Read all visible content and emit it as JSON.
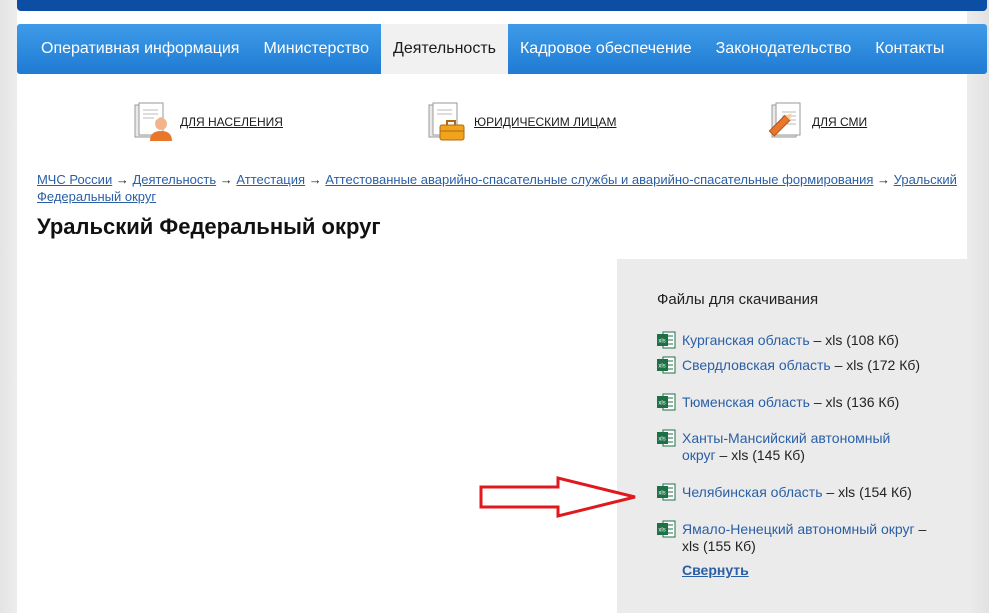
{
  "nav": {
    "items": [
      {
        "label": "Оперативная информация"
      },
      {
        "label": "Министерство"
      },
      {
        "label": "Деятельность"
      },
      {
        "label": "Кадровое обеспечение"
      },
      {
        "label": "Законодательство"
      },
      {
        "label": "Контакты"
      }
    ],
    "active": "Деятельность"
  },
  "audience": {
    "population": "ДЛЯ НАСЕЛЕНИЯ",
    "legal": "ЮРИДИЧЕСКИМ ЛИЦАМ",
    "media": "ДЛЯ СМИ"
  },
  "breadcrumb": {
    "items": [
      "МЧС России",
      "Деятельность",
      "Аттестация",
      "Аттестованные аварийно-спасательные службы и аварийно-спасательные формирования",
      "Уральский Федеральный округ"
    ],
    "separator": "→"
  },
  "page": {
    "title": "Уральский Федеральный округ"
  },
  "downloads": {
    "title": "Файлы для скачивания",
    "files": [
      {
        "name": "Курганская область",
        "meta": "– xls (108 Кб)"
      },
      {
        "name": "Свердловская область",
        "meta": "– xls (172 Кб)"
      },
      {
        "name": "Тюменская область",
        "meta": "– xls (136 Кб)"
      },
      {
        "name": "Ханты-Мансийский автономный округ",
        "meta": "– xls (145 Кб)"
      },
      {
        "name": "Челябинская область",
        "meta": "– xls (154 Кб)"
      },
      {
        "name": "Ямало-Ненецкий автономный округ",
        "meta": "– xls (155 Кб)"
      }
    ],
    "collapse": "Свернуть",
    "icon": "xls-file-icon"
  },
  "colors": {
    "nav": "#1f7bd3",
    "top_strip": "#0c4ea4",
    "link": "#2a5fa6",
    "xls_icon": "#1d7046",
    "arrow": "#e0191e"
  }
}
